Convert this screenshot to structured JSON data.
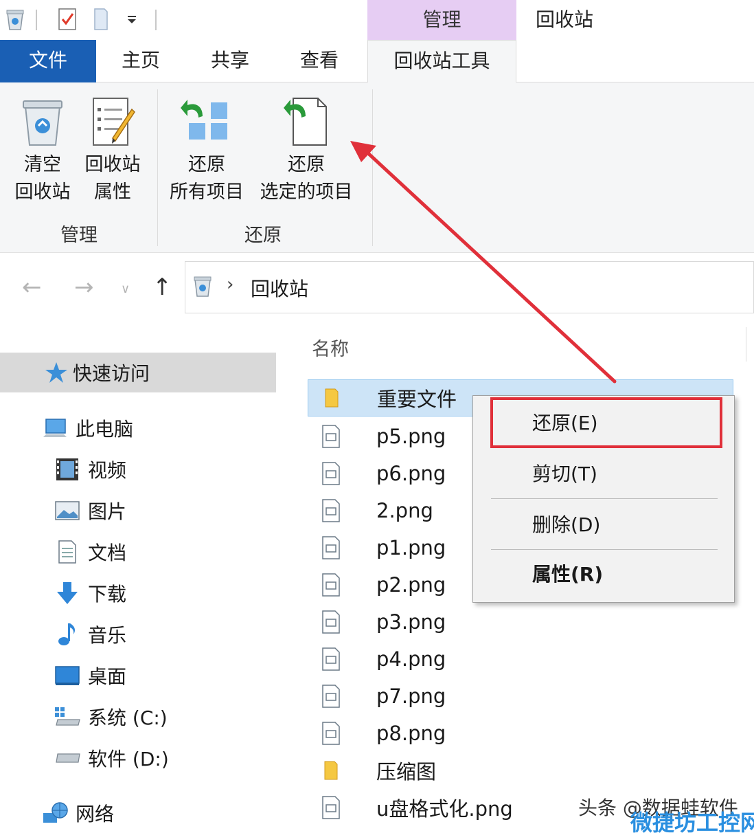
{
  "titlebar": {
    "context_group_label": "管理",
    "window_title": "回收站"
  },
  "tabs": {
    "file": "文件",
    "home": "主页",
    "share": "共享",
    "view": "查看",
    "recycle_tools": "回收站工具"
  },
  "ribbon": {
    "empty_line1": "清空",
    "empty_line2": "回收站",
    "props_line1": "回收站",
    "props_line2": "属性",
    "restore_all_line1": "还原",
    "restore_all_line2": "所有项目",
    "restore_sel_line1": "还原",
    "restore_sel_line2": "选定的项目",
    "group_manage": "管理",
    "group_restore": "还原"
  },
  "address": {
    "crumb": "回收站"
  },
  "nav": {
    "quick_access": "快速访问",
    "this_pc": "此电脑",
    "videos": "视频",
    "pictures": "图片",
    "documents": "文档",
    "downloads": "下载",
    "music": "音乐",
    "desktop": "桌面",
    "drive_c": "系统 (C:)",
    "drive_d": "软件 (D:)",
    "network": "网络"
  },
  "files": {
    "column_name": "名称",
    "items": [
      "重要文件",
      "p5.png",
      "p6.png",
      "2.png",
      "p1.png",
      "p2.png",
      "p3.png",
      "p4.png",
      "p7.png",
      "p8.png",
      "压缩图",
      "u盘格式化.png"
    ]
  },
  "context_menu": {
    "restore": "还原(E)",
    "cut": "剪切(T)",
    "delete": "删除(D)",
    "properties": "属性(R)"
  },
  "watermark": {
    "line1": "头条 @数据蛙软件",
    "line2": "微捷坊工控网"
  },
  "colors": {
    "file_tab": "#1a5fb4",
    "context_band": "#e6cdf3",
    "selection": "#cde4f7",
    "annotation_red": "#e0303a"
  }
}
